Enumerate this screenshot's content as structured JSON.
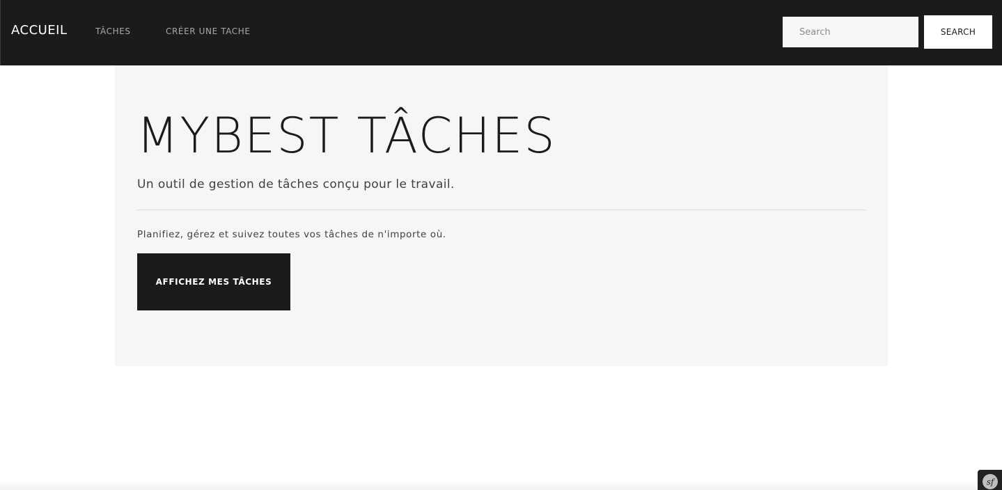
{
  "navbar": {
    "brand": "ACCUEIL",
    "links": [
      "TÂCHES",
      "CRÉER UNE TACHE"
    ],
    "search": {
      "placeholder": "Search",
      "value": "",
      "button_label": "SEARCH"
    }
  },
  "hero": {
    "title": "MYBEST TÂCHES",
    "lead": "Un outil de gestion de tâches conçu pour le travail.",
    "text": "Planifiez, gérez et suivez toutes vos tâches de n'importe où.",
    "button_label": "AFFICHEZ MES TÂCHES"
  },
  "debug_toolbar": {
    "icon": "symfony-icon"
  },
  "colors": {
    "navbar_bg": "#1b1b1c",
    "jumbotron_bg": "#f6f6f8",
    "primary_button": "#1b1b1c"
  }
}
